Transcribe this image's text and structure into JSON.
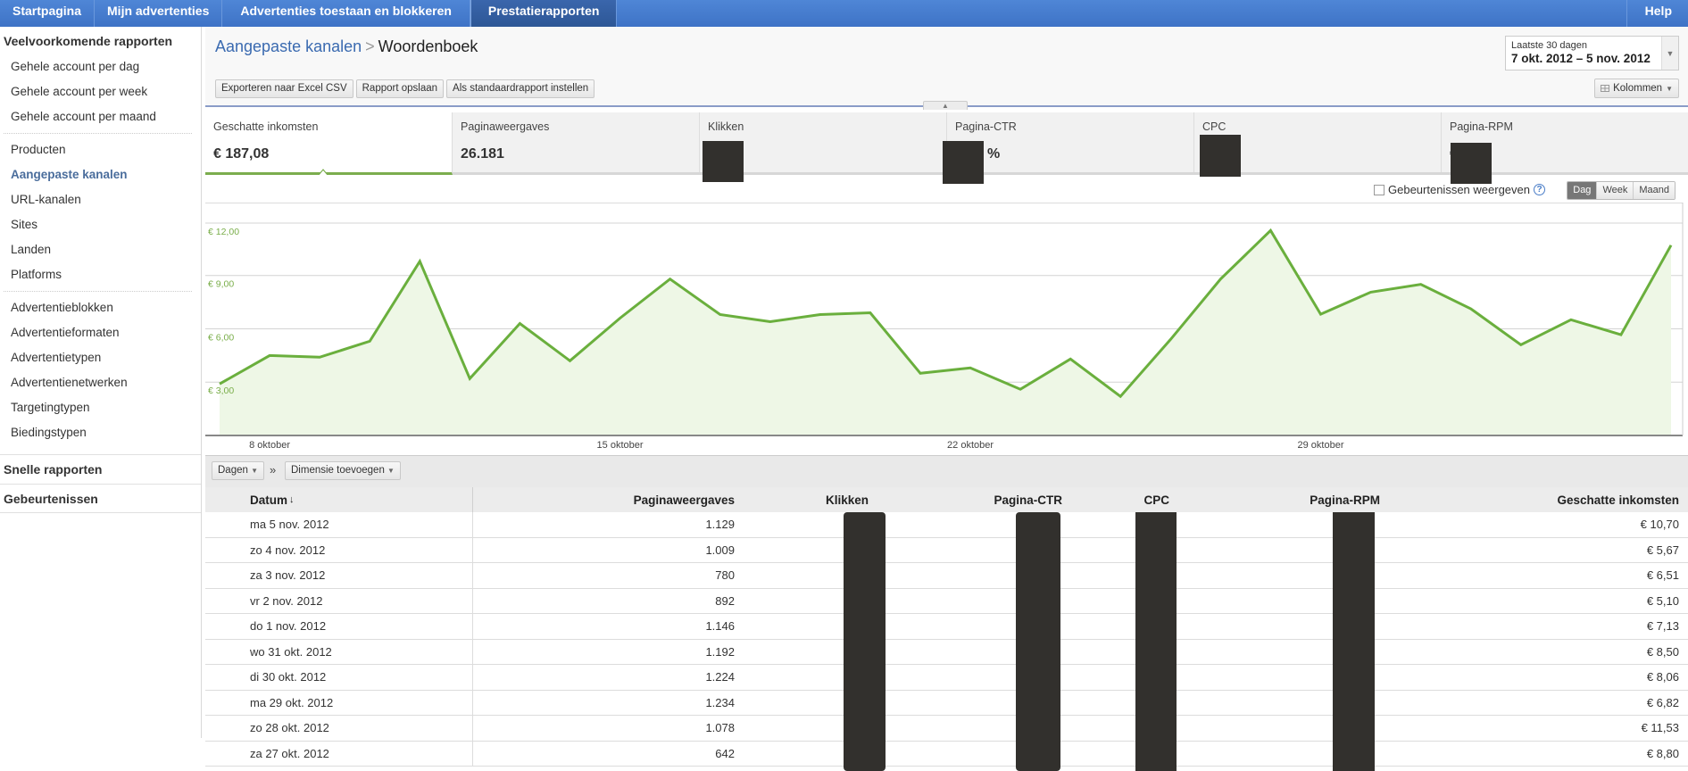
{
  "topnav": {
    "tabs": [
      {
        "label": "Startpagina",
        "active": false
      },
      {
        "label": "Mijn advertenties",
        "active": false
      },
      {
        "label": "Advertenties toestaan en blokkeren",
        "active": false
      },
      {
        "label": "Prestatierapporten",
        "active": true
      }
    ],
    "help_label": "Help"
  },
  "sidebar": {
    "section_title": "Veelvoorkomende rapporten",
    "group1": [
      "Gehele account per dag",
      "Gehele account per week",
      "Gehele account per maand"
    ],
    "group2": [
      "Producten",
      "Aangepaste kanalen",
      "URL-kanalen",
      "Sites",
      "Landen",
      "Platforms"
    ],
    "group2_active": "Aangepaste kanalen",
    "group3": [
      "Advertentieblokken",
      "Advertentieformaten",
      "Advertentietypen",
      "Advertentienetwerken",
      "Targetingtypen",
      "Biedingstypen"
    ],
    "quick_reports": "Snelle rapporten",
    "events": "Gebeurtenissen"
  },
  "header": {
    "breadcrumb_parent": "Aangepaste kanalen",
    "breadcrumb_sep": ">",
    "breadcrumb_current": "Woordenboek",
    "buttons": [
      "Exporteren naar Excel CSV",
      "Rapport opslaan",
      "Als standaardrapport instellen"
    ],
    "date_label": "Laatste 30 dagen",
    "date_value": "7 okt. 2012 – 5 nov. 2012",
    "columns_button": "Kolommen"
  },
  "scorecards": [
    {
      "label": "Geschatte inkomsten",
      "value": "€ 187,08",
      "active": true,
      "redacted": false
    },
    {
      "label": "Paginaweergaves",
      "value": "26.181",
      "active": false,
      "redacted": false
    },
    {
      "label": "Klikken",
      "value": "",
      "active": false,
      "redacted": true
    },
    {
      "label": "Pagina-CTR",
      "value": "%",
      "active": false,
      "redacted": true
    },
    {
      "label": "CPC",
      "value": "€",
      "active": false,
      "redacted": true
    },
    {
      "label": "Pagina-RPM",
      "value": "€",
      "active": false,
      "redacted": true
    }
  ],
  "chart_controls": {
    "events_checkbox_label": "Gebeurtenissen weergeven",
    "events_checked": false,
    "help_glyph": "?",
    "granularity": [
      "Dag",
      "Week",
      "Maand"
    ],
    "granularity_selected": "Dag"
  },
  "chart_data": {
    "type": "area",
    "title": "",
    "series": [
      {
        "name": "Geschatte inkomsten",
        "color": "#6aaf3d",
        "values": [
          2.9,
          4.5,
          4.4,
          5.3,
          9.8,
          3.2,
          6.3,
          4.2,
          6.6,
          8.8,
          6.8,
          6.4,
          6.8,
          6.9,
          3.5,
          3.8,
          2.6,
          4.3,
          2.2,
          5.4,
          8.8,
          11.53,
          6.82,
          8.06,
          8.5,
          7.13,
          5.1,
          6.51,
          5.67,
          10.7
        ]
      }
    ],
    "x_start": "7 oktober",
    "x_end": "5 november",
    "x_tick_labels": [
      {
        "label": "8 oktober",
        "index": 1
      },
      {
        "label": "15 oktober",
        "index": 8
      },
      {
        "label": "22 oktober",
        "index": 15
      },
      {
        "label": "29 oktober",
        "index": 22
      }
    ],
    "y_tick_labels": [
      "€ 3,00",
      "€ 6,00",
      "€ 9,00",
      "€ 12,00"
    ],
    "y_ticks": [
      3,
      6,
      9,
      12
    ],
    "ylim": [
      0,
      12.6
    ],
    "grid": true,
    "legend": "none",
    "xlabel": "",
    "ylabel": ""
  },
  "dimension_bar": {
    "dim_button": "Dagen",
    "separator": "»",
    "add_button": "Dimensie toevoegen"
  },
  "table": {
    "columns": [
      "Datum",
      "Paginaweergaves",
      "Klikken",
      "Pagina-CTR",
      "CPC",
      "Pagina-RPM",
      "Geschatte inkomsten"
    ],
    "sort_glyph": "↓",
    "rows": [
      {
        "date": "ma 5 nov. 2012",
        "pageviews": "1.129",
        "income": "€ 10,70"
      },
      {
        "date": "zo 4 nov. 2012",
        "pageviews": "1.009",
        "income": "€ 5,67"
      },
      {
        "date": "za 3 nov. 2012",
        "pageviews": "780",
        "income": "€ 6,51"
      },
      {
        "date": "vr 2 nov. 2012",
        "pageviews": "892",
        "income": "€ 5,10"
      },
      {
        "date": "do 1 nov. 2012",
        "pageviews": "1.146",
        "income": "€ 7,13"
      },
      {
        "date": "wo 31 okt. 2012",
        "pageviews": "1.192",
        "income": "€ 8,50"
      },
      {
        "date": "di 30 okt. 2012",
        "pageviews": "1.224",
        "income": "€ 8,06"
      },
      {
        "date": "ma 29 okt. 2012",
        "pageviews": "1.234",
        "income": "€ 6,82"
      },
      {
        "date": "zo 28 okt. 2012",
        "pageviews": "1.078",
        "income": "€ 11,53"
      },
      {
        "date": "za 27 okt. 2012",
        "pageviews": "642",
        "income": "€ 8,80"
      }
    ]
  },
  "colors": {
    "nav_blue": "#4a7fd0",
    "accent_green": "#6aaf3d",
    "link_blue": "#3a6ab0",
    "redaction": "#32302d"
  }
}
